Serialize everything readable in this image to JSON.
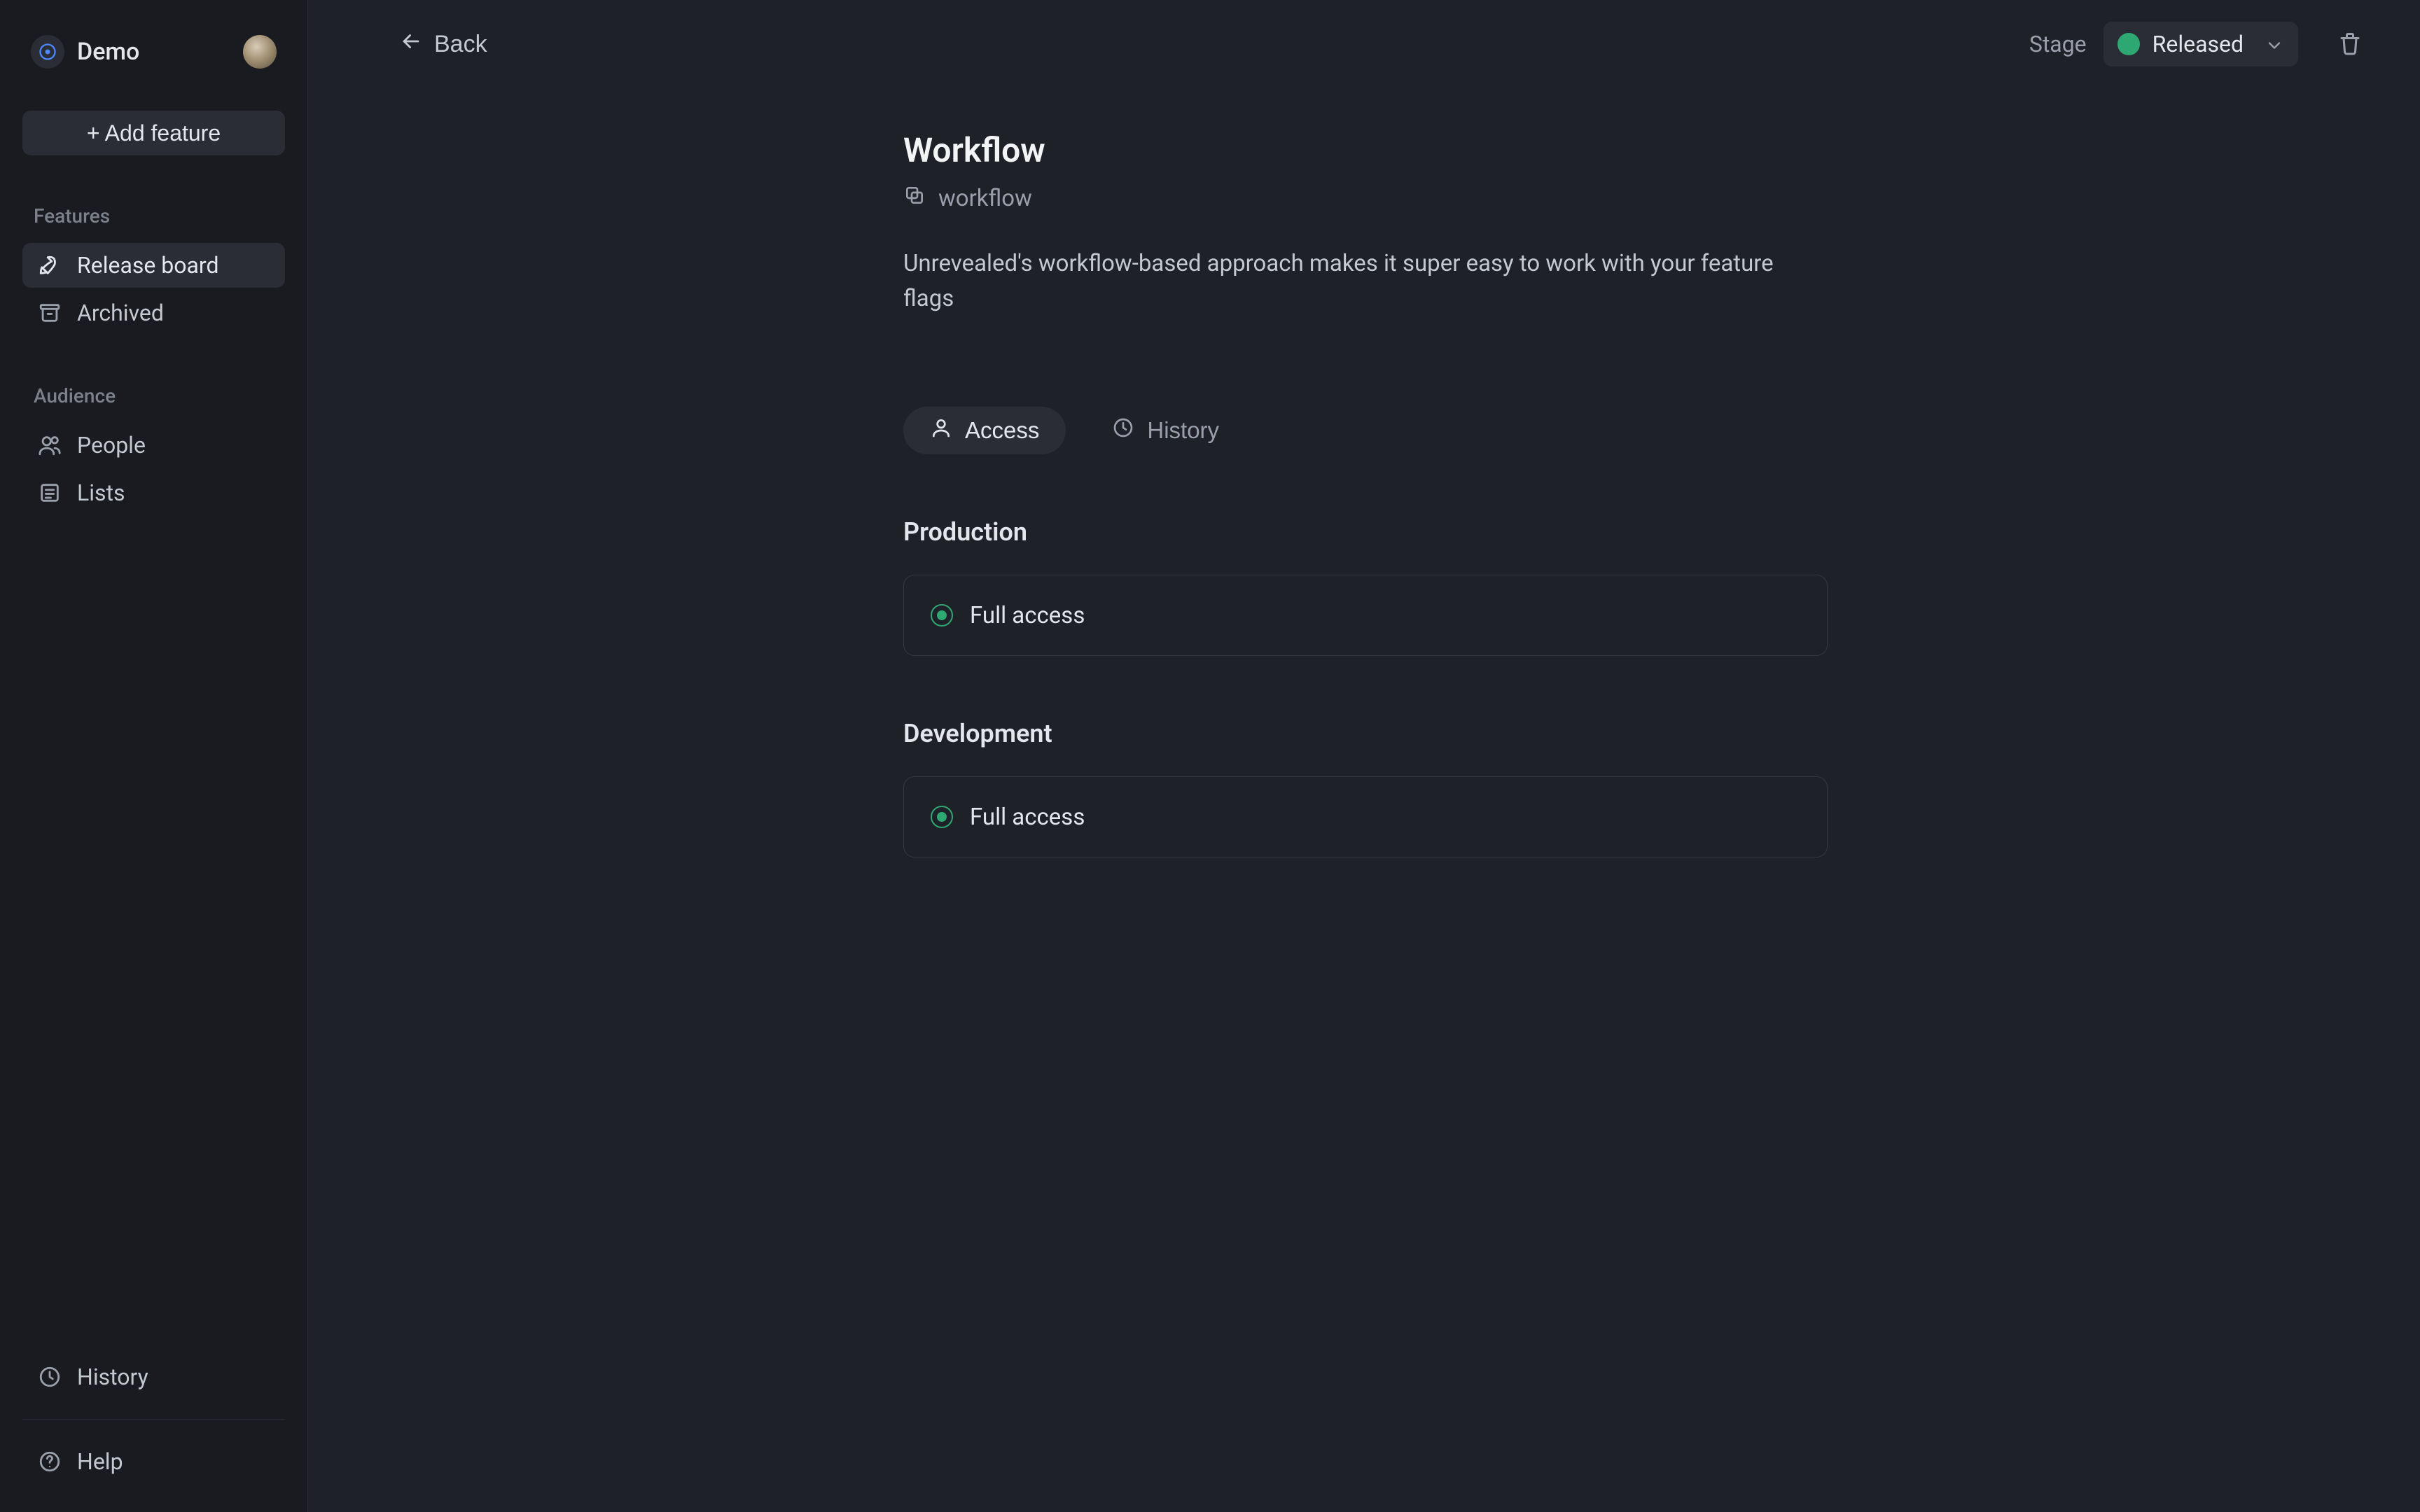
{
  "sidebar": {
    "workspace_name": "Demo",
    "add_feature_label": "+ Add feature",
    "sections": {
      "features_label": "Features",
      "audience_label": "Audience"
    },
    "items": {
      "release_board": "Release board",
      "archived": "Archived",
      "people": "People",
      "lists": "Lists",
      "history": "History",
      "help": "Help"
    }
  },
  "topbar": {
    "back_label": "Back",
    "stage_label": "Stage",
    "stage_value": "Released"
  },
  "page": {
    "title": "Workflow",
    "slug": "workflow",
    "description": "Unrevealed's workflow-based approach makes it super easy to work with your feature flags"
  },
  "tabs": {
    "access": "Access",
    "history": "History"
  },
  "environments": [
    {
      "name": "Production",
      "access_label": "Full access"
    },
    {
      "name": "Development",
      "access_label": "Full access"
    }
  ],
  "colors": {
    "accent_green": "#2ea872",
    "panel": "#2a2d36",
    "bg": "#1e2128",
    "sidebar_bg": "#191b21"
  }
}
